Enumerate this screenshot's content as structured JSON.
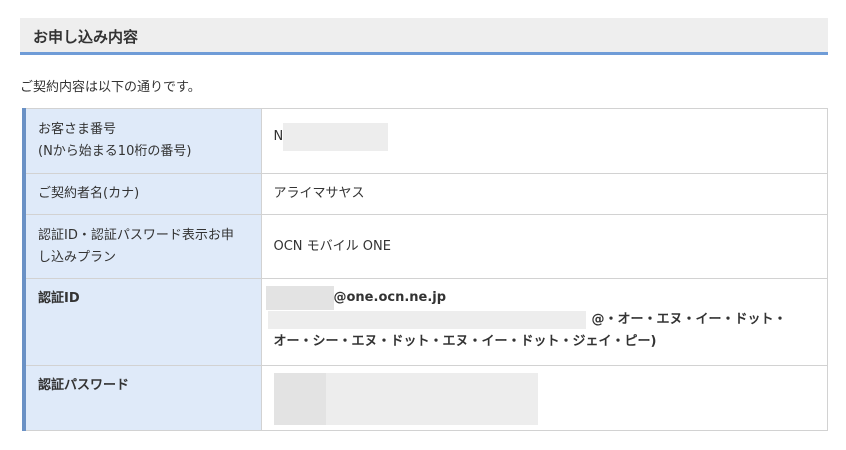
{
  "section": {
    "title": "お申し込み内容"
  },
  "intro": "ご契約内容は以下の通りです。",
  "rows": {
    "customer_number": {
      "label_line1": "お客さま番号",
      "label_line2": "(Nから始まる10桁の番号)",
      "value_prefix": "N"
    },
    "contract_name": {
      "label": "ご契約者名(カナ)",
      "value": "アライマサヤス"
    },
    "plan": {
      "label_line1": "認証ID・認証パスワード表示お申",
      "label_line2": "し込みプラン",
      "value": "OCN モバイル ONE"
    },
    "auth_id": {
      "label": "認証ID",
      "value_domain": "@one.ocn.ne.jp",
      "reading_line1": "@・オー・エヌ・イー・ドット・",
      "reading_line2": "オー・シー・エヌ・ドット・エヌ・イー・ドット・ジェイ・ピー)"
    },
    "auth_password": {
      "label": "認証パスワード"
    }
  }
}
